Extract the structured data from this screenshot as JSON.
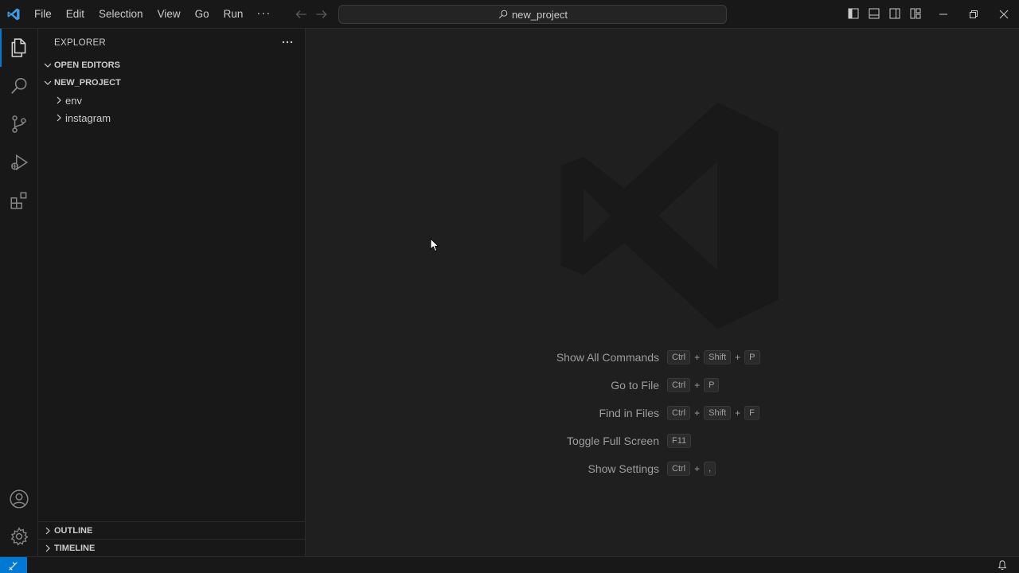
{
  "titlebar": {
    "menu": [
      "File",
      "Edit",
      "Selection",
      "View",
      "Go",
      "Run"
    ],
    "more": "···",
    "search_text": "new_project"
  },
  "sidebar": {
    "title": "EXPLORER",
    "open_editors": "OPEN EDITORS",
    "project": "NEW_PROJECT",
    "folders": [
      "env",
      "instagram"
    ],
    "outline": "OUTLINE",
    "timeline": "TIMELINE"
  },
  "editor": {
    "shortcuts": [
      {
        "label": "Show All Commands",
        "keys": [
          "Ctrl",
          "Shift",
          "P"
        ]
      },
      {
        "label": "Go to File",
        "keys": [
          "Ctrl",
          "P"
        ]
      },
      {
        "label": "Find in Files",
        "keys": [
          "Ctrl",
          "Shift",
          "F"
        ]
      },
      {
        "label": "Toggle Full Screen",
        "keys": [
          "F11"
        ]
      },
      {
        "label": "Show Settings",
        "keys": [
          "Ctrl",
          ","
        ]
      }
    ]
  },
  "colors": {
    "accent": "#0078d4",
    "background": "#1f1f1f",
    "sidebar": "#181818"
  }
}
